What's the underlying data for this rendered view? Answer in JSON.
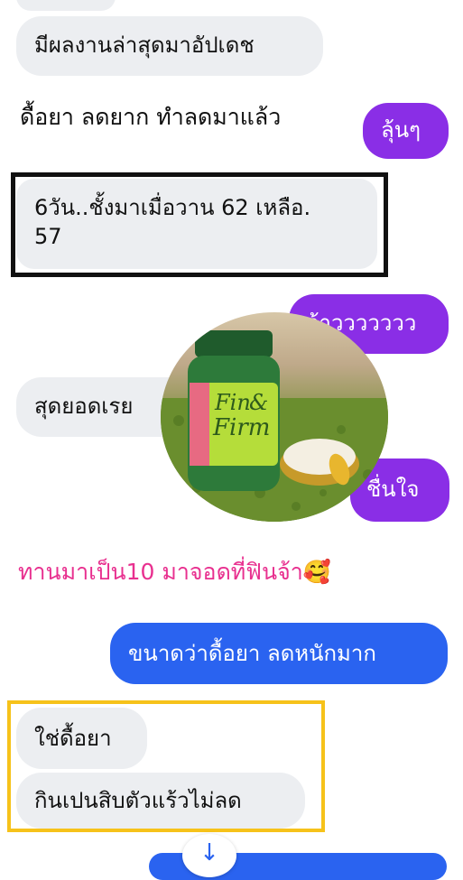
{
  "chat": {
    "msg_latest_update": "มีผลงานล่าสุดมาอัปเดช",
    "text_stubborn": "ดื้อยา ลดยาก ทำลดมาแล้ว",
    "reply_lunn": "ลุ้นๆ",
    "weight_report": "6วัน..ชั้งมาเมื่อวาน 62 เหลือ.",
    "weight_report_line2": "57",
    "reply_waa": "ว้าววววววว",
    "msg_great": "สุดยอดเรย",
    "reply_glad": "ชื่นใจ",
    "overlay_caption": "ทานมาเป็น10  มาจอดที่ฟินจ้า",
    "overlay_emoji": "🥰",
    "reply_size": "ขนาดว่าดื้อยา ลดหนักมาก",
    "msg_yes": "ใช่ดื้อยา",
    "msg_ate": "กินเปนสิบตัวแร้วไม่ลด",
    "scroll_icon": "↓"
  },
  "product": {
    "brand_line1": "Fin",
    "brand_ampersand": "&",
    "brand_line2": "Firm"
  },
  "colors": {
    "incoming_bubble": "#eceef1",
    "outgoing_purple": "#8a2ee6",
    "outgoing_blue": "#2a63f0",
    "highlight_black": "#111111",
    "highlight_yellow": "#f6c21a",
    "caption_pink": "#e8308f"
  }
}
